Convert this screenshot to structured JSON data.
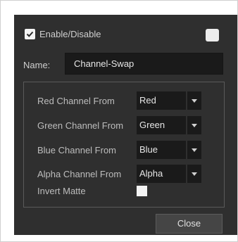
{
  "enable": {
    "label": "Enable/Disable",
    "checked": true
  },
  "name_field": {
    "label": "Name:",
    "value": "Channel-Swap"
  },
  "channels": [
    {
      "label": "Red Channel From",
      "value": "Red"
    },
    {
      "label": "Green Channel From",
      "value": "Green"
    },
    {
      "label": "Blue Channel From",
      "value": "Blue"
    },
    {
      "label": "Alpha Channel From",
      "value": "Alpha"
    }
  ],
  "invert_matte": {
    "label": "Invert Matte",
    "checked": false
  },
  "close_label": "Close",
  "colors": {
    "dialog_bg": "#2f2f2f",
    "field_bg": "#1a1a1a",
    "text": "#cfcfcf"
  }
}
